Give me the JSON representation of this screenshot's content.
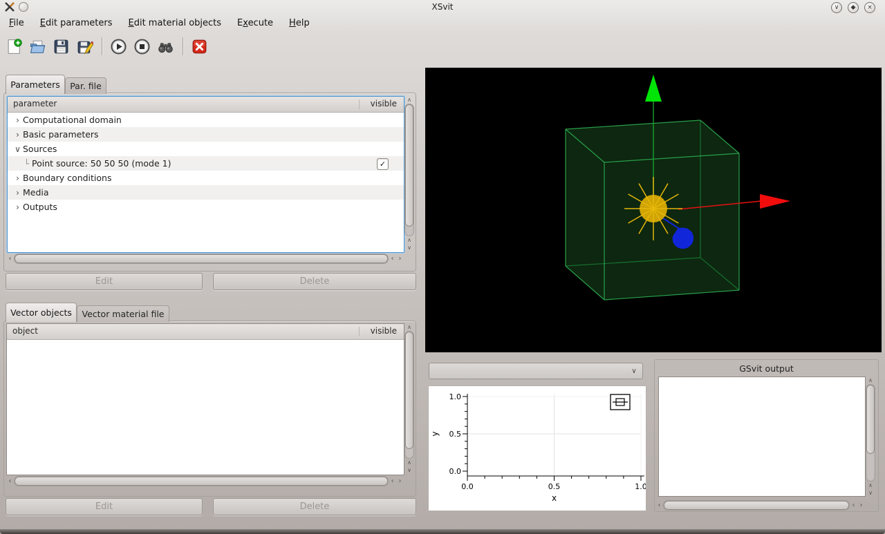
{
  "window": {
    "title": "XSvit"
  },
  "titlebar": {
    "buttons": {
      "shade": "∨",
      "maximize": "◆",
      "close": "×"
    }
  },
  "menu": {
    "items": [
      {
        "pre": "",
        "accel": "F",
        "post": "ile"
      },
      {
        "pre": "",
        "accel": "E",
        "post": "dit parameters"
      },
      {
        "pre": "",
        "accel": "E",
        "post": "dit material objects"
      },
      {
        "pre": "E",
        "accel": "x",
        "post": "ecute"
      },
      {
        "pre": "",
        "accel": "H",
        "post": "elp"
      }
    ]
  },
  "toolbar": {
    "icons": [
      "new-file",
      "open-file",
      "save-file",
      "save-file-as",
      "run",
      "stop",
      "find",
      "quit"
    ]
  },
  "icons": {
    "up": "∧",
    "down": "∨",
    "left": "‹",
    "right": "›",
    "check": "✓",
    "combo_arrow": "∨"
  },
  "parameters_panel": {
    "tabs": [
      {
        "label": "Parameters"
      },
      {
        "label": "Par. file"
      }
    ],
    "header": {
      "col1": "parameter",
      "col2": "visible"
    },
    "rows": [
      {
        "expander": "›",
        "label": "Computational domain",
        "child": false,
        "checked": false
      },
      {
        "expander": "›",
        "label": "Basic parameters",
        "child": false,
        "checked": false
      },
      {
        "expander": "∨",
        "label": "Sources",
        "child": false,
        "checked": false
      },
      {
        "expander": "└",
        "label": "Point source: 50 50 50 (mode 1)",
        "child": true,
        "checked": true
      },
      {
        "expander": "›",
        "label": "Boundary conditions",
        "child": false,
        "checked": false
      },
      {
        "expander": "›",
        "label": "Media",
        "child": false,
        "checked": false
      },
      {
        "expander": "›",
        "label": "Outputs",
        "child": false,
        "checked": false
      }
    ],
    "buttons": {
      "edit": "Edit",
      "delete": "Delete"
    }
  },
  "vector_panel": {
    "tabs": [
      {
        "label": "Vector objects"
      },
      {
        "label": "Vector material file"
      }
    ],
    "header": {
      "col1": "object",
      "col2": "visible"
    },
    "rows": [],
    "buttons": {
      "edit": "Edit",
      "delete": "Delete"
    }
  },
  "viewport": {
    "colors": {
      "background": "#000000",
      "cube_fill": "#0d2710",
      "cube_edge": "#28a04a",
      "cube_edge_back": "#17702f",
      "y_axis": "#17a32c",
      "y_arrow": "#00e408",
      "x_axis": "#e81010",
      "x_arrow": "#f20d0d",
      "point_source": "#cfa402",
      "source_rays": "#e7b70a",
      "material_object": "#1126d8"
    }
  },
  "combo": {
    "value": ""
  },
  "output_panel": {
    "title": "GSvit output"
  },
  "chart_data": {
    "type": "line",
    "title": "",
    "xlabel": "x",
    "ylabel": "y",
    "xlim": [
      0.0,
      1.0
    ],
    "ylim": [
      0.0,
      1.0
    ],
    "xticks": [
      0.0,
      0.5,
      1.0
    ],
    "yticks": [
      0.0,
      0.5,
      1.0
    ],
    "minor_tick_step": 0.1,
    "grid": true,
    "legend": "none",
    "series": []
  }
}
